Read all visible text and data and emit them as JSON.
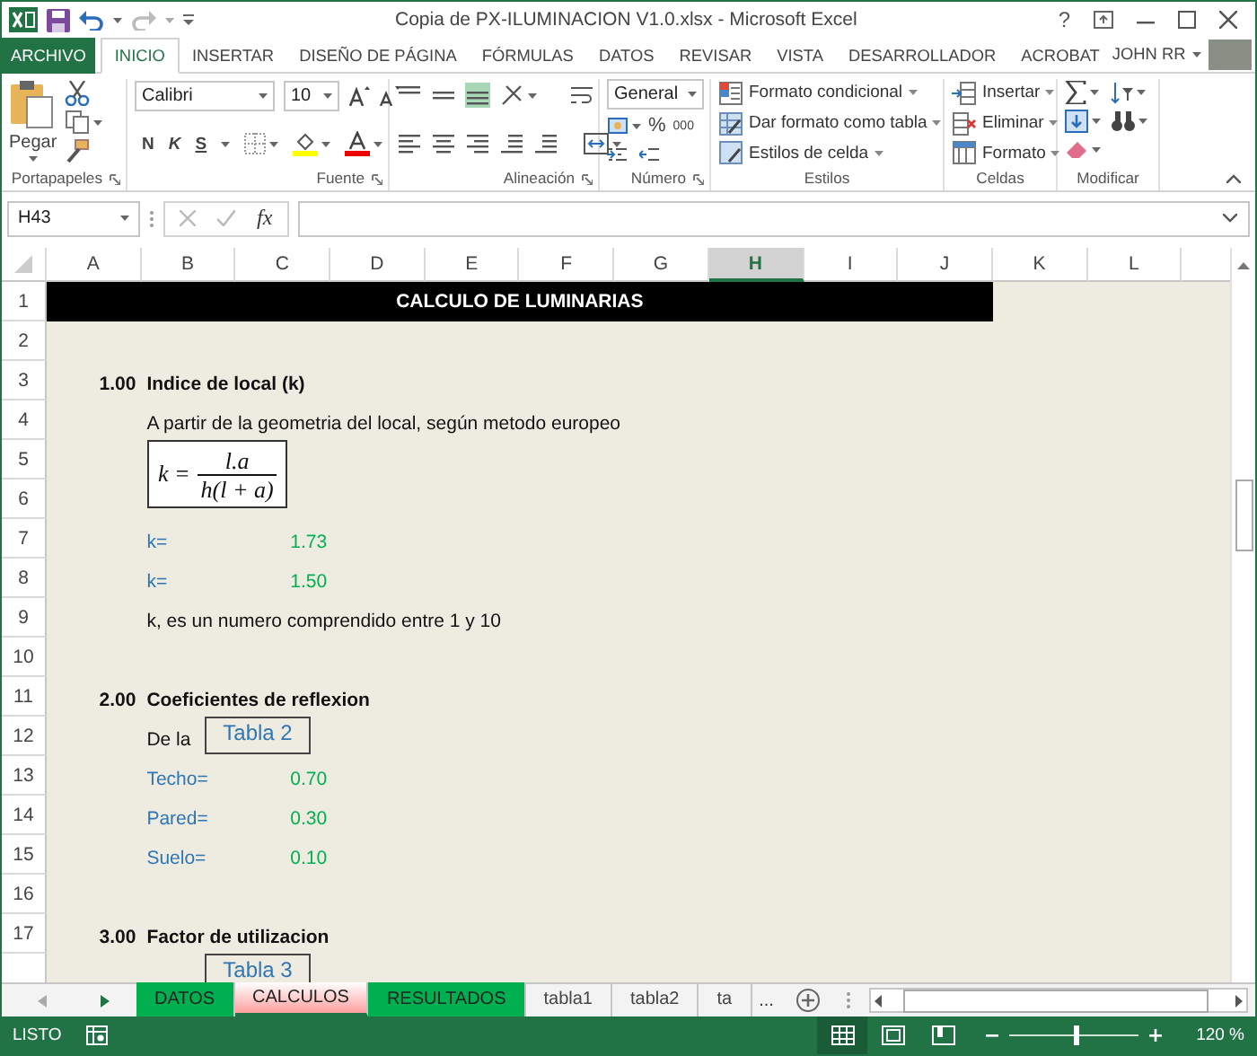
{
  "window": {
    "title": "Copia de PX-ILUMINACION V1.0.xlsx - Microsoft Excel",
    "help": "?"
  },
  "ribbon_tabs": [
    {
      "label": "ARCHIVO",
      "kind": "file",
      "selected": false
    },
    {
      "label": "INICIO",
      "kind": "tab",
      "selected": true
    },
    {
      "label": "INSERTAR",
      "kind": "tab",
      "selected": false
    },
    {
      "label": "DISEÑO DE PÁGINA",
      "kind": "tab",
      "selected": false
    },
    {
      "label": "FÓRMULAS",
      "kind": "tab",
      "selected": false
    },
    {
      "label": "DATOS",
      "kind": "tab",
      "selected": false
    },
    {
      "label": "REVISAR",
      "kind": "tab",
      "selected": false
    },
    {
      "label": "VISTA",
      "kind": "tab",
      "selected": false
    },
    {
      "label": "DESARROLLADOR",
      "kind": "tab",
      "selected": false
    },
    {
      "label": "ACROBAT",
      "kind": "tab",
      "selected": false
    }
  ],
  "account": {
    "user": "JOHN RR"
  },
  "ribbon": {
    "clipboard": {
      "group": "Portapapeles",
      "paste": "Pegar"
    },
    "font": {
      "group": "Fuente",
      "font_name": "Calibri",
      "font_size": "10",
      "bold": "N",
      "italic": "K",
      "underline": "S"
    },
    "alignment": {
      "group": "Alineación"
    },
    "number": {
      "group": "Número",
      "format": "General",
      "percent": "%",
      "thousands": "000"
    },
    "styles": {
      "group": "Estilos",
      "items": [
        "Formato condicional",
        "Dar formato como tabla",
        "Estilos de celda"
      ]
    },
    "cells": {
      "group": "Celdas",
      "items": [
        "Insertar",
        "Eliminar",
        "Formato"
      ]
    },
    "editing": {
      "group": "Modificar"
    }
  },
  "formula_bar": {
    "name_box": "H43",
    "function_label": "fx"
  },
  "columns": [
    {
      "label": "A",
      "selected": false
    },
    {
      "label": "B",
      "selected": false
    },
    {
      "label": "C",
      "selected": false
    },
    {
      "label": "D",
      "selected": false
    },
    {
      "label": "E",
      "selected": false
    },
    {
      "label": "F",
      "selected": false
    },
    {
      "label": "G",
      "selected": false
    },
    {
      "label": "H",
      "selected": true
    },
    {
      "label": "I",
      "selected": false
    },
    {
      "label": "J",
      "selected": false
    },
    {
      "label": "K",
      "selected": false
    },
    {
      "label": "L",
      "selected": false
    }
  ],
  "rows": [
    {
      "number": "1",
      "cells": [
        {
          "kind": "title",
          "text": "CALCULO DE LUMINARIAS"
        }
      ]
    },
    {
      "number": "2"
    },
    {
      "number": "3",
      "cells": [
        {
          "kind": "section_number",
          "text": "1.00"
        },
        {
          "kind": "heading",
          "text": "Indice de local (k)"
        }
      ]
    },
    {
      "number": "4",
      "cells": [
        {
          "kind": "text",
          "text": "A partir de la geometria del local, según metodo europeo"
        }
      ]
    },
    {
      "number": "5",
      "shape": {
        "kind": "formula",
        "lhs": "k =",
        "numerator": "l.a",
        "denominator": "h(l + a)"
      }
    },
    {
      "number": "6"
    },
    {
      "number": "7",
      "cells": [
        {
          "kind": "label",
          "text": "k="
        },
        {
          "kind": "value",
          "text": "1.73"
        }
      ]
    },
    {
      "number": "8",
      "cells": [
        {
          "kind": "label",
          "text": "k="
        },
        {
          "kind": "value",
          "text": "1.50"
        }
      ]
    },
    {
      "number": "9",
      "cells": [
        {
          "kind": "text",
          "text": "k, es un numero comprendido entre 1 y 10"
        }
      ]
    },
    {
      "number": "10"
    },
    {
      "number": "11",
      "cells": [
        {
          "kind": "section_number",
          "text": "2.00"
        },
        {
          "kind": "heading",
          "text": "Coeficientes de reflexion"
        }
      ]
    },
    {
      "number": "12",
      "cells": [
        {
          "kind": "text",
          "text": "De la"
        }
      ],
      "shape": {
        "kind": "link_box",
        "text": "Tabla 2"
      }
    },
    {
      "number": "13",
      "cells": [
        {
          "kind": "label",
          "text": "Techo="
        },
        {
          "kind": "value",
          "text": "0.70"
        }
      ]
    },
    {
      "number": "14",
      "cells": [
        {
          "kind": "label",
          "text": "Pared="
        },
        {
          "kind": "value",
          "text": "0.30"
        }
      ]
    },
    {
      "number": "15",
      "cells": [
        {
          "kind": "label",
          "text": "Suelo="
        },
        {
          "kind": "value",
          "text": "0.10"
        }
      ]
    },
    {
      "number": "16"
    },
    {
      "number": "17",
      "cells": [
        {
          "kind": "section_number",
          "text": "3.00"
        },
        {
          "kind": "heading",
          "text": "Factor de utilizacion"
        }
      ]
    },
    {
      "shape": {
        "kind": "link_box",
        "text": "Tabla 3"
      }
    }
  ],
  "sheet_tabs": [
    {
      "label": "DATOS",
      "color": "#00b050",
      "selected": false
    },
    {
      "label": "CALCULOS",
      "color": "#ff9f9f",
      "selected": true
    },
    {
      "label": "RESULTADOS",
      "color": "#00b050",
      "selected": false
    },
    {
      "label": "tabla1",
      "selected": false
    },
    {
      "label": "tabla2",
      "selected": false
    },
    {
      "label": "ta",
      "selected": false
    }
  ],
  "more_sheets": "...",
  "status_bar": {
    "state": "LISTO",
    "views": [
      {
        "kind": "normal",
        "selected": true
      },
      {
        "kind": "page_layout",
        "selected": false
      },
      {
        "kind": "page_break",
        "selected": false
      }
    ],
    "zoom": {
      "level": 0.52,
      "reading": "120 %"
    }
  }
}
